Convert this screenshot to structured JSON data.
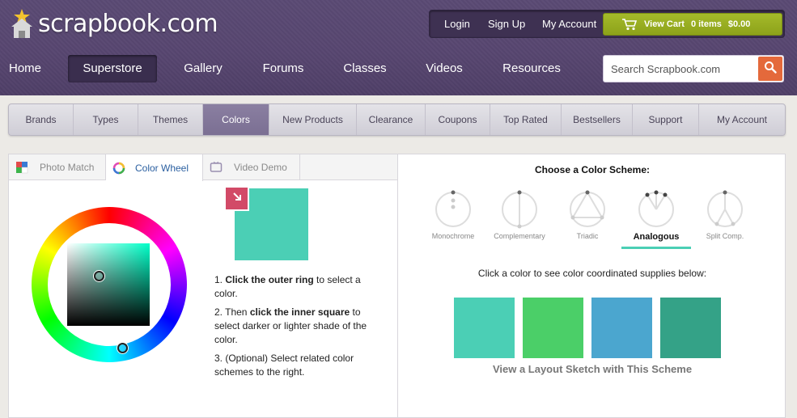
{
  "brand": {
    "logo_text": "scrapbook.com"
  },
  "account": {
    "login": "Login",
    "signup": "Sign Up",
    "my_account": "My Account",
    "cart_label": "View Cart",
    "cart_items": "0 items",
    "cart_total": "$0.00"
  },
  "main_nav": [
    "Home",
    "Superstore",
    "Gallery",
    "Forums",
    "Classes",
    "Videos",
    "Resources"
  ],
  "main_nav_active": "Superstore",
  "search": {
    "placeholder": "Search Scrapbook.com"
  },
  "sub_nav": [
    "Brands",
    "Types",
    "Themes",
    "Colors",
    "New Products",
    "Clearance",
    "Coupons",
    "Top Rated",
    "Bestsellers",
    "Support",
    "My Account"
  ],
  "sub_nav_active": "Colors",
  "tabs": [
    {
      "label": "Photo Match",
      "icon": "photo-match-icon"
    },
    {
      "label": "Color Wheel",
      "icon": "color-wheel-icon"
    },
    {
      "label": "Video Demo",
      "icon": "video-icon"
    }
  ],
  "tabs_active": "Color Wheel",
  "picker": {
    "current_color": "#4bcfb5",
    "previous_color": "#d24a67"
  },
  "instructions": {
    "step1_num": "1. ",
    "step1_bold": "Click the outer ring",
    "step1_rest": " to select a color.",
    "step2_num": "2. Then ",
    "step2_bold": "click the inner square",
    "step2_rest": " to select darker or lighter shade of the color.",
    "step3": "3. (Optional) Select related color schemes to the right."
  },
  "schemes": {
    "title": "Choose a Color Scheme:",
    "options": [
      "Monochrome",
      "Complementary",
      "Triadic",
      "Analogous",
      "Split Comp."
    ],
    "active": "Analogous"
  },
  "click_prompt": "Click a color to see color coordinated supplies below:",
  "swatches": [
    "#4bcfb5",
    "#4bcf68",
    "#4ba6cf",
    "#34a287"
  ],
  "sketch_link": "View a Layout Sketch with This Scheme",
  "colors": {
    "header": "#574670",
    "cart": "#9ab022",
    "search_button": "#e4693b",
    "accent": "#4bcfb5"
  }
}
